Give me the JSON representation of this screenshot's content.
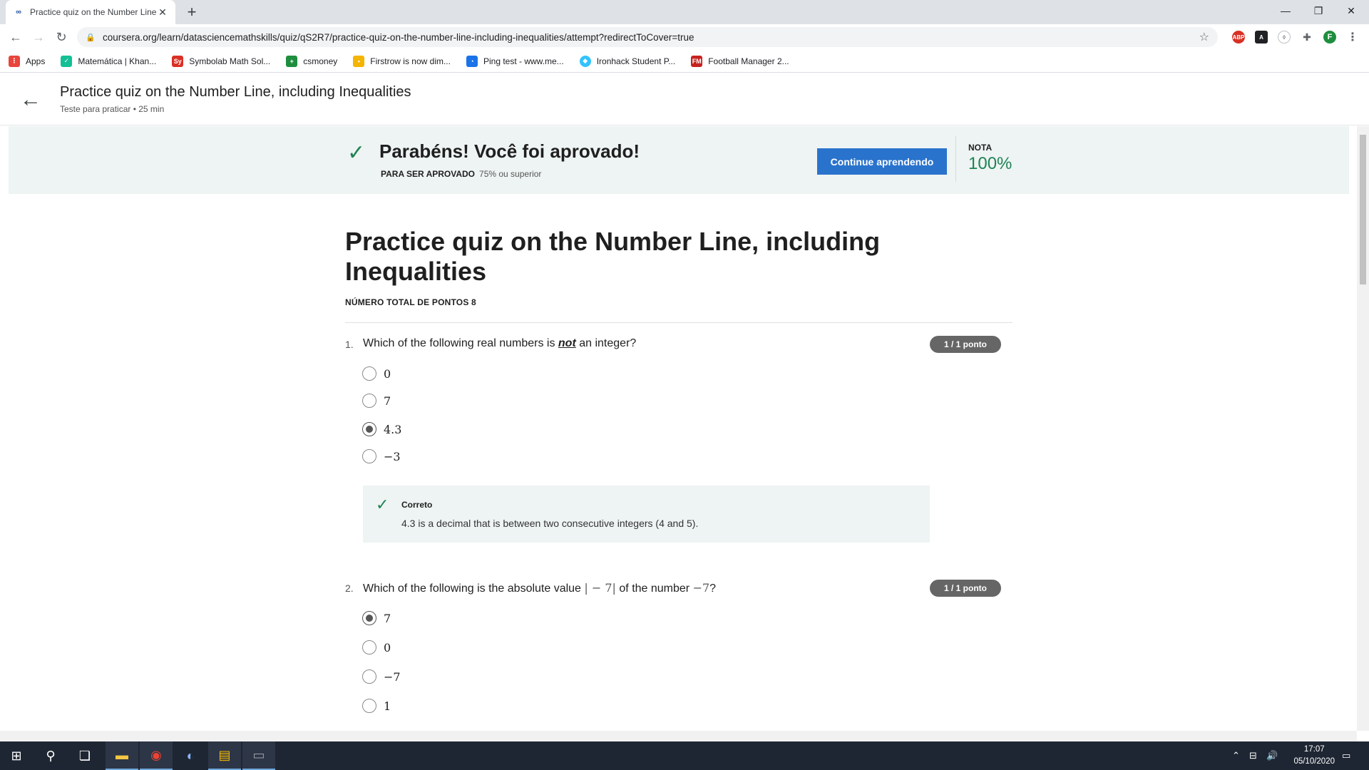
{
  "browser": {
    "tab_title": "Practice quiz on the Number Line",
    "url": "coursera.org/learn/datasciencemathskills/quiz/qS2R7/practice-quiz-on-the-number-line-including-inequalities/attempt?redirectToCover=true",
    "bookmarks": [
      {
        "label": "Apps",
        "icon": "apps-grid-icon",
        "color": "#e8453c"
      },
      {
        "label": "Matemática | Khan...",
        "icon": "khan-icon",
        "color": "#14bf96"
      },
      {
        "label": "Symbolab Math Sol...",
        "icon": "symbolab-icon",
        "color": "#d93025"
      },
      {
        "label": "csmoney",
        "icon": "csmoney-icon",
        "color": "#1e8e3e"
      },
      {
        "label": "Firstrow is now dim...",
        "icon": "firstrow-icon",
        "color": "#f4b400"
      },
      {
        "label": "Ping test - www.me...",
        "icon": "ping-icon",
        "color": "#1a73e8"
      },
      {
        "label": "Ironhack Student P...",
        "icon": "ironhack-icon",
        "color": "#32c3ff"
      },
      {
        "label": "Football Manager 2...",
        "icon": "fm-icon",
        "color": "#c5221f"
      }
    ],
    "profile_initial": "F"
  },
  "header": {
    "title": "Practice quiz on the Number Line, including Inequalities",
    "subtitle": "Teste para praticar • 25 min"
  },
  "banner": {
    "title": "Parabéns! Você foi aprovado!",
    "pass_label": "PARA SER APROVADO",
    "pass_value": "75% ou superior",
    "button": "Continue aprendendo",
    "grade_label": "NOTA",
    "grade_value": "100%"
  },
  "quiz": {
    "title": "Practice quiz on the Number Line, including Inequalities",
    "total_points": "NÚMERO TOTAL DE PONTOS 8",
    "questions": [
      {
        "number": "1.",
        "text_before": "Which of the following real numbers is ",
        "text_emph": "not",
        "text_after": " an integer?",
        "points": "1 / 1 ponto",
        "options": [
          "0",
          "7",
          "4.3",
          "−3"
        ],
        "selected_index": 2,
        "feedback_title": "Correto",
        "feedback_text": "4.3 is a decimal that is between two consecutive integers (4 and 5)."
      },
      {
        "number": "2.",
        "text_before": "Which of the following is the absolute value ",
        "text_math1": "| − 7|",
        "text_mid": " of the number ",
        "text_math2": "−7",
        "text_after": "?",
        "points": "1 / 1 ponto",
        "options": [
          "7",
          "0",
          "−7",
          "1"
        ],
        "selected_index": 0
      }
    ]
  },
  "taskbar": {
    "time": "17:07",
    "date": "05/10/2020"
  },
  "colors": {
    "accent_green": "#1f8354",
    "button_blue": "#2a73cc",
    "banner_bg": "#eef4f3"
  }
}
